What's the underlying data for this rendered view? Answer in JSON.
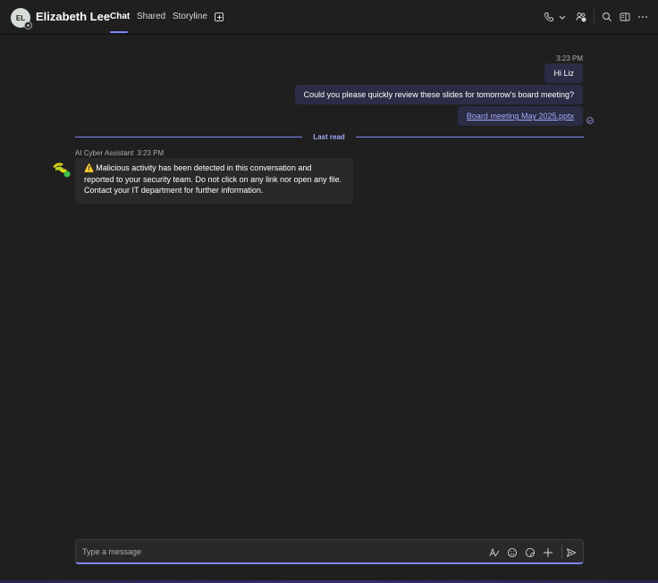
{
  "header": {
    "avatar_initials": "EL",
    "contact_name": "Elizabeth Lee",
    "tabs": [
      {
        "label": "Chat",
        "active": true
      },
      {
        "label": "Shared",
        "active": false
      },
      {
        "label": "Storyline",
        "active": false
      }
    ],
    "icons": [
      "add-tab-icon",
      "phone-icon",
      "chevron-down-icon",
      "people-icon",
      "search-icon",
      "side-panel-icon",
      "more-icon"
    ]
  },
  "messages": {
    "sent_time": "3:23 PM",
    "sent": [
      {
        "text": "Hi Liz"
      },
      {
        "text": "Could you please quickly review these slides for tomorrow's board meeting?"
      },
      {
        "text": "Board meeting May 2025.pptx",
        "is_link": true
      }
    ],
    "last_read_label": "Last read",
    "bot": {
      "sender": "AI Cyber Assistant",
      "time": "3:23 PM",
      "warning_icon": "⚠️",
      "lines": [
        "Malicious activity has been detected in this conversation and",
        "reported to your security team. Do not click on any link nor open any file.",
        "Contact your IT department for further information."
      ]
    }
  },
  "composer": {
    "placeholder": "Type a message",
    "value": "",
    "icons": [
      "format-icon",
      "emoji-icon",
      "sticker-icon",
      "attach-plus-icon",
      "send-icon"
    ]
  },
  "colors": {
    "accent": "#7f85f5",
    "background": "#1f1f1f",
    "sent_bubble": "#2b2c45",
    "received_bubble": "#292929"
  }
}
